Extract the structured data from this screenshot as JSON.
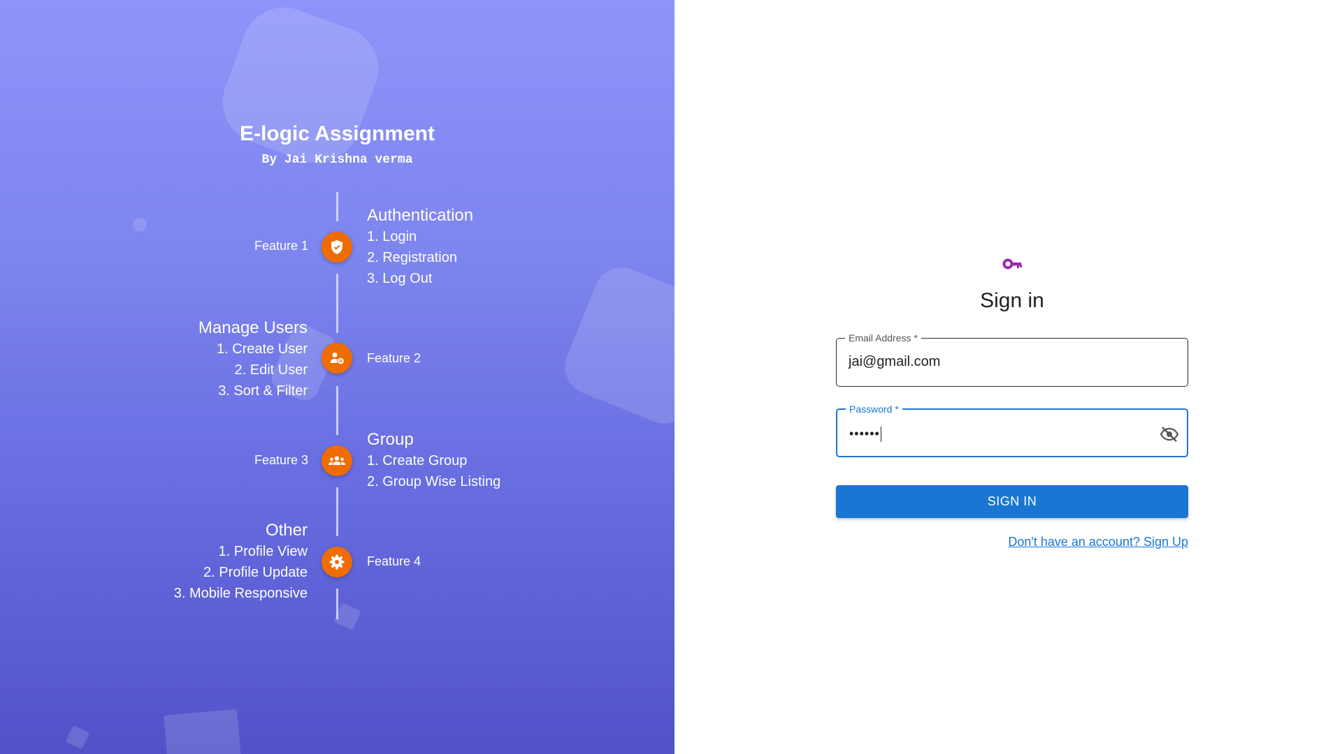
{
  "header": {
    "title": "E-logic Assignment",
    "subtitle": "By Jai Krishna verma"
  },
  "features": [
    {
      "label": "Feature 1",
      "heading": "Authentication",
      "items": [
        "1. Login",
        "2. Registration",
        "3. Log Out"
      ],
      "icon": "shield-check-icon"
    },
    {
      "label": "Feature 2",
      "heading": "Manage Users",
      "items": [
        "1. Create User",
        "2. Edit User",
        "3. Sort & Filter"
      ],
      "icon": "manage-user-icon"
    },
    {
      "label": "Feature 3",
      "heading": "Group",
      "items": [
        "1. Create Group",
        "2. Group Wise Listing"
      ],
      "icon": "group-icon"
    },
    {
      "label": "Feature 4",
      "heading": "Other",
      "items": [
        "1. Profile View",
        "2. Profile Update",
        "3. Mobile Responsive"
      ],
      "icon": "gear-icon"
    }
  ],
  "signin": {
    "icon": "key-icon",
    "title": "Sign in",
    "email": {
      "label": "Email Address *",
      "value": "jai@gmail.com"
    },
    "password": {
      "label": "Password *",
      "value": "••••••",
      "toggle_icon": "visibility-off-icon"
    },
    "button_label": "SIGN IN",
    "signup_link": "Don't have an account? Sign Up"
  },
  "colors": {
    "gradient_top": "#8d94f9",
    "gradient_bottom": "#5252c9",
    "feature_dot": "#ef6c00",
    "primary": "#1976d2",
    "key_icon": "#9c27b0"
  }
}
